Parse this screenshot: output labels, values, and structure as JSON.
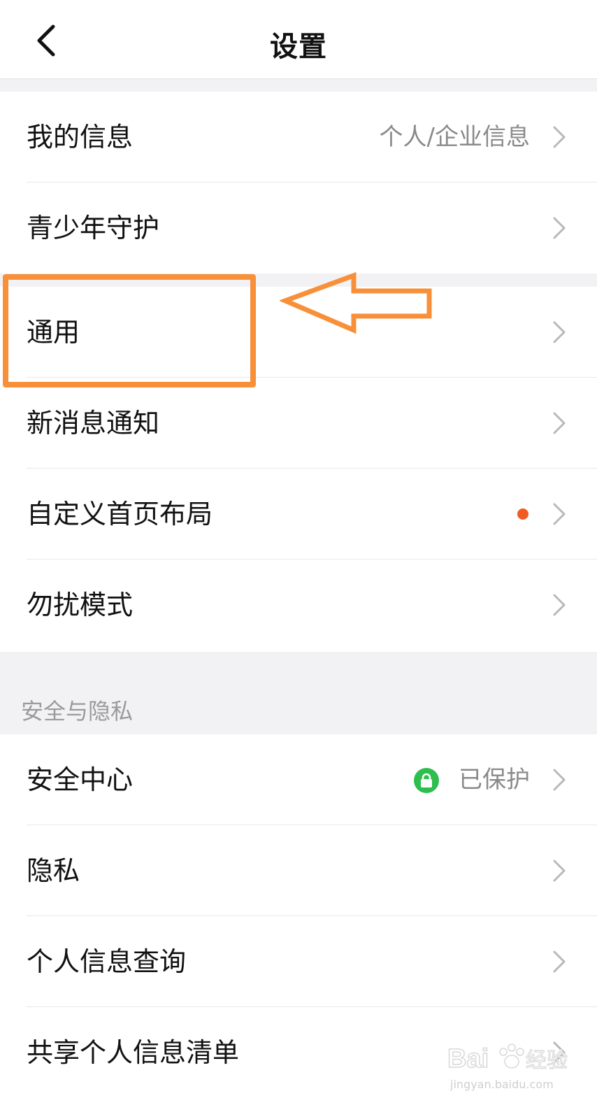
{
  "nav": {
    "title": "设置"
  },
  "rows": [
    {
      "label": "我的信息",
      "value": "个人/企业信息"
    },
    {
      "label": "青少年守护"
    },
    {
      "label": "通用"
    },
    {
      "label": "新消息通知"
    },
    {
      "label": "自定义首页布局"
    },
    {
      "label": "勿扰模式"
    },
    {
      "label": "安全中心",
      "value": "已保护"
    },
    {
      "label": "隐私"
    },
    {
      "label": "个人信息查询"
    },
    {
      "label": "共享个人信息清单"
    }
  ],
  "section": {
    "security_title": "安全与隐私"
  },
  "colors": {
    "accent_dot": "#f25a22",
    "lock_green": "#2dbe4e",
    "highlight": "#f8903a"
  },
  "watermark": {
    "brand": "Bai",
    "brand_tail": "经验",
    "url": "jingyan.baidu.com"
  }
}
